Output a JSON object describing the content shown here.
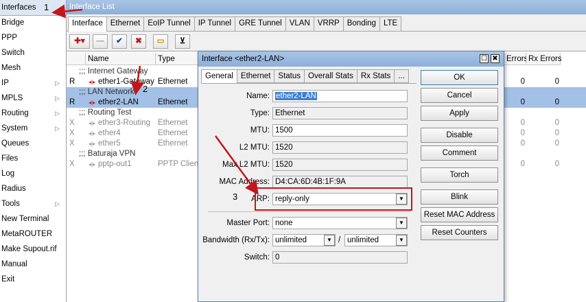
{
  "menu": {
    "items": [
      {
        "label": "Interfaces",
        "sub": false
      },
      {
        "label": "Bridge",
        "sub": false
      },
      {
        "label": "PPP",
        "sub": false
      },
      {
        "label": "Switch",
        "sub": false
      },
      {
        "label": "Mesh",
        "sub": false
      },
      {
        "label": "IP",
        "sub": true
      },
      {
        "label": "MPLS",
        "sub": true
      },
      {
        "label": "Routing",
        "sub": true
      },
      {
        "label": "System",
        "sub": true
      },
      {
        "label": "Queues",
        "sub": false
      },
      {
        "label": "Files",
        "sub": false
      },
      {
        "label": "Log",
        "sub": false
      },
      {
        "label": "Radius",
        "sub": false
      },
      {
        "label": "Tools",
        "sub": true
      },
      {
        "label": "New Terminal",
        "sub": false
      },
      {
        "label": "MetaROUTER",
        "sub": false
      },
      {
        "label": "Make Supout.rif",
        "sub": false
      },
      {
        "label": "Manual",
        "sub": false
      },
      {
        "label": "Exit",
        "sub": false
      }
    ],
    "submenu_glyph": "▷",
    "annotation": "1"
  },
  "interface_list": {
    "title": "Interface List",
    "tabs": [
      "Interface",
      "Ethernet",
      "EoIP Tunnel",
      "IP Tunnel",
      "GRE Tunnel",
      "VLAN",
      "VRRP",
      "Bonding",
      "LTE"
    ],
    "toolbar": {
      "add": "✚▾",
      "remove": "—",
      "enable": "✔",
      "disable": "✖",
      "comment": "▭",
      "filter": "⊻"
    },
    "columns": {
      "name": "Name",
      "type": "Type",
      "tx_errors": "Errors",
      "rx_errors": "Rx Errors"
    },
    "rows": [
      {
        "kind": "comment",
        "flag": "",
        "name": ";;; Internet Gateway",
        "type": "",
        "tx": "",
        "rx": ""
      },
      {
        "kind": "iface",
        "flag": "R",
        "name": "ether1-Gateway",
        "type": "Ethernet",
        "tx": "0",
        "rx": "0"
      },
      {
        "kind": "comment-sel",
        "flag": "",
        "name": ";;; LAN Network",
        "type": "",
        "tx": "",
        "rx": ""
      },
      {
        "kind": "iface-sel",
        "flag": "R",
        "name": "ether2-LAN",
        "type": "Ethernet",
        "tx": "0",
        "rx": "0"
      },
      {
        "kind": "comment",
        "flag": "",
        "name": ";;; Routing Test",
        "type": "",
        "tx": "",
        "rx": ""
      },
      {
        "kind": "disabled",
        "flag": "X",
        "name": "ether3-Routing",
        "type": "Ethernet",
        "tx": "0",
        "rx": "0"
      },
      {
        "kind": "disabled",
        "flag": "X",
        "name": "ether4",
        "type": "Ethernet",
        "tx": "0",
        "rx": "0"
      },
      {
        "kind": "disabled",
        "flag": "X",
        "name": "ether5",
        "type": "Ethernet",
        "tx": "0",
        "rx": "0"
      },
      {
        "kind": "comment",
        "flag": "",
        "name": ";;; Baturaja VPN",
        "type": "",
        "tx": "",
        "rx": ""
      },
      {
        "kind": "disabled",
        "flag": "X",
        "name": "pptp-out1",
        "type": "PPTP Client",
        "tx": "0",
        "rx": "0"
      }
    ],
    "iface_glyph": "◂|▸",
    "annotation": "2"
  },
  "dialog": {
    "title": "Interface <ether2-LAN>",
    "win_buttons": {
      "maximize": "☐",
      "close": "✖"
    },
    "tabs": [
      "General",
      "Ethernet",
      "Status",
      "Overall Stats",
      "Rx Stats",
      "..."
    ],
    "fields": {
      "name": {
        "label": "Name:",
        "value": "ether2-LAN"
      },
      "type": {
        "label": "Type:",
        "value": "Ethernet"
      },
      "mtu": {
        "label": "MTU:",
        "value": "1500"
      },
      "l2mtu": {
        "label": "L2 MTU:",
        "value": "1520"
      },
      "max_l2mtu": {
        "label": "Max L2 MTU:",
        "value": "1520"
      },
      "mac": {
        "label": "MAC Address:",
        "value": "D4:CA:6D:4B:1F:9A"
      },
      "arp": {
        "label": "ARP:",
        "value": "reply-only"
      },
      "master_port": {
        "label": "Master Port:",
        "value": "none"
      },
      "bandwidth": {
        "label": "Bandwidth (Rx/Tx):",
        "rx": "unlimited",
        "sep": "/",
        "tx": "unlimited"
      },
      "switch": {
        "label": "Switch:",
        "value": "0"
      }
    },
    "dropdown_glyph": "▼",
    "buttons": [
      "OK",
      "Cancel",
      "Apply",
      "Disable",
      "Comment",
      "Torch",
      "Blink",
      "Reset MAC Address",
      "Reset Counters"
    ],
    "annotation": "3"
  },
  "colors": {
    "selected_row": "#a3c1e6",
    "annotation_red": "#c0161c",
    "title_bar": "#8cb0d9"
  }
}
